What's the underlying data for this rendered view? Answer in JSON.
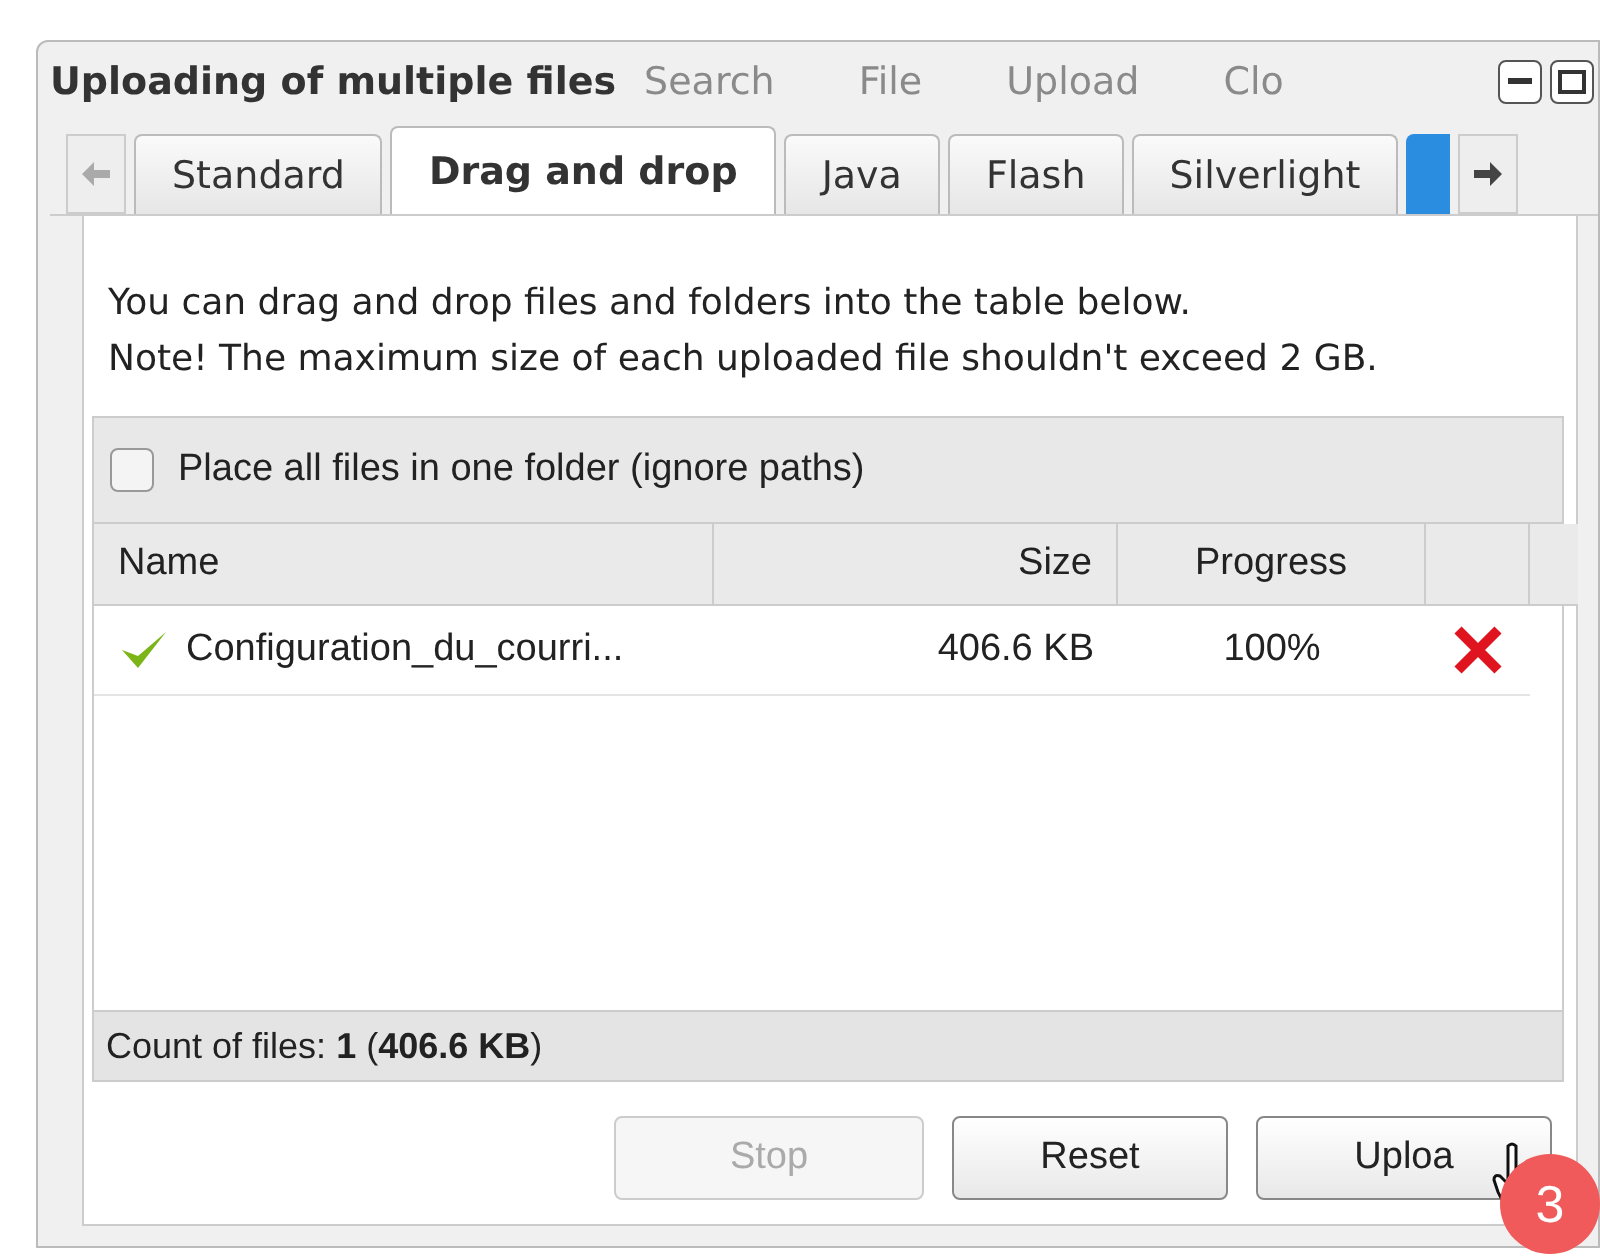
{
  "window": {
    "title": "Uploading of multiple files"
  },
  "background_toolbar": [
    "Search",
    "File",
    "Upload",
    "Clo"
  ],
  "tabs": [
    {
      "label": "Standard",
      "selected": false
    },
    {
      "label": "Drag and drop",
      "selected": true
    },
    {
      "label": "Java",
      "selected": false
    },
    {
      "label": "Flash",
      "selected": false
    },
    {
      "label": "Silverlight",
      "selected": false
    }
  ],
  "info": [
    "You can drag and drop files and folders into the table below.",
    "Note! The maximum size of each uploaded file shouldn't exceed 2 GB."
  ],
  "option": {
    "label": "Place all files in one folder (ignore paths)",
    "checked": false
  },
  "table": {
    "columns": [
      "Name",
      "Size",
      "Progress"
    ],
    "rows": [
      {
        "name": "Configuration_du_courri...",
        "size": "406.6 KB",
        "progress": "100%",
        "done": true
      }
    ]
  },
  "status_bar": "Count of files: **1** (**406.6 KB**)",
  "buttons": [
    {
      "label": "Stop",
      "disabled": true
    },
    {
      "label": "Reset",
      "disabled": false
    },
    {
      "label": "Uploa",
      "disabled": false
    }
  ],
  "step_badge": "3"
}
